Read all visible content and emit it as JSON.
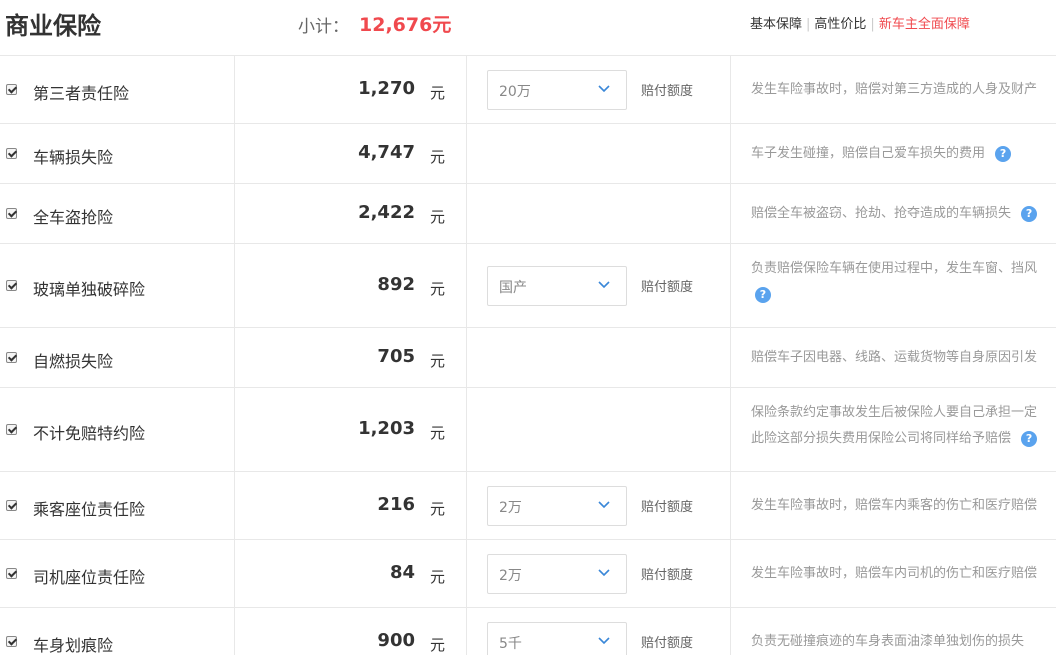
{
  "header": {
    "title": "商业保险",
    "subtotal_label": "小计：",
    "subtotal_value": "12,676元",
    "plans": [
      {
        "label": "基本保障",
        "active": false
      },
      {
        "label": "高性价比",
        "active": false
      },
      {
        "label": "新车主全面保障",
        "active": true
      }
    ]
  },
  "unit": "元",
  "coverage_label": "赔付额度",
  "help_glyph": "?",
  "items": [
    {
      "name": "第三者责任险",
      "price": "1,270",
      "option": "20万",
      "desc1": "发生车险事故时，赔偿对第三方造成的人身及财产",
      "desc2": "",
      "checked": true
    },
    {
      "name": "车辆损失险",
      "price": "4,747",
      "option": "",
      "desc1": "车子发生碰撞，赔偿自己爱车损失的费用",
      "desc2": "",
      "checked": true
    },
    {
      "name": "全车盗抢险",
      "price": "2,422",
      "option": "",
      "desc1": "赔偿全车被盗窃、抢劫、抢夺造成的车辆损失",
      "desc2": "",
      "checked": true
    },
    {
      "name": "玻璃单独破碎险",
      "price": "892",
      "option": "国产",
      "desc1": "负责赔偿保险车辆在使用过程中，发生车窗、挡风",
      "desc2": "",
      "checked": true
    },
    {
      "name": "自燃损失险",
      "price": "705",
      "option": "",
      "desc1": "赔偿车子因电器、线路、运载货物等自身原因引发",
      "desc2": "",
      "checked": true
    },
    {
      "name": "不计免赔特约险",
      "price": "1,203",
      "option": "",
      "desc1": "保险条款约定事故发生后被保险人要自己承担一定",
      "desc2": "此险这部分损失费用保险公司将同样给予赔偿",
      "checked": true
    },
    {
      "name": "乘客座位责任险",
      "price": "216",
      "option": "2万",
      "desc1": "发生车险事故时，赔偿车内乘客的伤亡和医疗赔偿",
      "desc2": "",
      "checked": true
    },
    {
      "name": "司机座位责任险",
      "price": "84",
      "option": "2万",
      "desc1": "发生车险事故时，赔偿车内司机的伤亡和医疗赔偿",
      "desc2": "",
      "checked": true
    },
    {
      "name": "车身划痕险",
      "price": "900",
      "option": "5千",
      "desc1": "负责无碰撞痕迹的车身表面油漆单独划伤的损失",
      "desc2": "",
      "checked": true
    }
  ]
}
